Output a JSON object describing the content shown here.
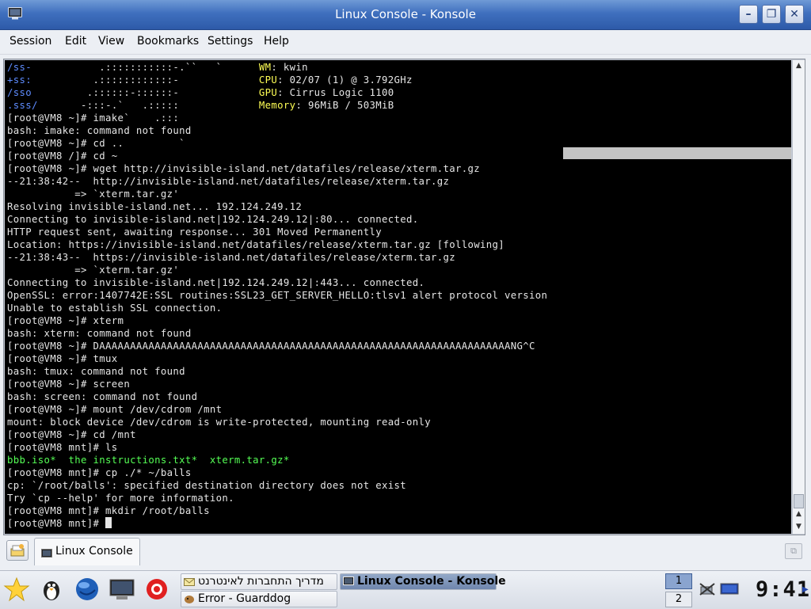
{
  "window": {
    "title": "Linux Console - Konsole",
    "buttons": {
      "minimize": "–",
      "maximize": "❐",
      "close": "✕"
    }
  },
  "menu": [
    "Session",
    "Edit",
    "View",
    "Bookmarks",
    "Settings",
    "Help"
  ],
  "terminal": {
    "lines": [
      [
        {
          "t": "/ss-",
          "c": "blue"
        },
        {
          "t": "           .:::::::::::-.``   `      "
        },
        {
          "t": "WM",
          "c": "yellow"
        },
        {
          "t": ": kwin"
        }
      ],
      [
        {
          "t": "+ss:",
          "c": "blue"
        },
        {
          "t": "          .::::::::::::-             "
        },
        {
          "t": "CPU",
          "c": "yellow"
        },
        {
          "t": ": 02/07 (1) @ 3.792GHz"
        }
      ],
      [
        {
          "t": "/sso",
          "c": "blue"
        },
        {
          "t": "         .::::::-::::::-             "
        },
        {
          "t": "GPU",
          "c": "yellow"
        },
        {
          "t": ": Cirrus Logic 1100"
        }
      ],
      [
        {
          "t": ".sss/",
          "c": "blue"
        },
        {
          "t": "       -:::-.`   .:::::             "
        },
        {
          "t": "Memory",
          "c": "yellow"
        },
        {
          "t": ": 96MiB / 503MiB"
        }
      ],
      [
        {
          "t": "[root@VM8 ~]# imake`    .:::"
        }
      ],
      [
        {
          "t": "bash: imake: command not found"
        }
      ],
      [
        {
          "t": "[root@VM8 ~]# cd ..         `"
        }
      ],
      [
        {
          "t": "[root@VM8 /]# cd ~"
        }
      ],
      [
        {
          "t": "[root@VM8 ~]# wget http://invisible-island.net/datafiles/release/xterm.tar.gz"
        }
      ],
      [
        {
          "t": "--21:38:42--  http://invisible-island.net/datafiles/release/xterm.tar.gz"
        }
      ],
      [
        {
          "t": "           => `xterm.tar.gz'"
        }
      ],
      [
        {
          "t": "Resolving invisible-island.net... 192.124.249.12"
        }
      ],
      [
        {
          "t": "Connecting to invisible-island.net|192.124.249.12|:80... connected."
        }
      ],
      [
        {
          "t": "HTTP request sent, awaiting response... 301 Moved Permanently"
        }
      ],
      [
        {
          "t": "Location: https://invisible-island.net/datafiles/release/xterm.tar.gz [following]"
        }
      ],
      [
        {
          "t": "--21:38:43--  https://invisible-island.net/datafiles/release/xterm.tar.gz"
        }
      ],
      [
        {
          "t": "           => `xterm.tar.gz'"
        }
      ],
      [
        {
          "t": "Connecting to invisible-island.net|192.124.249.12|:443... connected."
        }
      ],
      [
        {
          "t": "OpenSSL: error:1407742E:SSL routines:SSL23_GET_SERVER_HELLO:tlsv1 alert protocol version"
        }
      ],
      [
        {
          "t": "Unable to establish SSL connection."
        }
      ],
      [
        {
          "t": "[root@VM8 ~]# xterm"
        }
      ],
      [
        {
          "t": "bash: xterm: command not found"
        }
      ],
      [
        {
          "t": "[root@VM8 ~]# DAAAAAAAAAAAAAAAAAAAAAAAAAAAAAAAAAAAAAAAAAAAAAAAAAAAAAAAAAAAAAAAAAAANG^C"
        }
      ],
      [
        {
          "t": "[root@VM8 ~]# tmux"
        }
      ],
      [
        {
          "t": "bash: tmux: command not found"
        }
      ],
      [
        {
          "t": "[root@VM8 ~]# screen"
        }
      ],
      [
        {
          "t": "bash: screen: command not found"
        }
      ],
      [
        {
          "t": "[root@VM8 ~]# mount /dev/cdrom /mnt"
        }
      ],
      [
        {
          "t": "mount: block device /dev/cdrom is write-protected, mounting read-only"
        }
      ],
      [
        {
          "t": "[root@VM8 ~]# cd /mnt"
        }
      ],
      [
        {
          "t": "[root@VM8 mnt]# ls"
        }
      ],
      [
        {
          "t": "bbb.iso*  the instructions.txt*  xterm.tar.gz*",
          "c": "green"
        }
      ],
      [
        {
          "t": "[root@VM8 mnt]# cp ./* ~/balls"
        }
      ],
      [
        {
          "t": "cp: `/root/balls': specified destination directory does not exist"
        }
      ],
      [
        {
          "t": "Try `cp --help' for more information."
        }
      ],
      [
        {
          "t": "[root@VM8 mnt]# mkdir /root/balls"
        }
      ],
      [
        {
          "t": "[root@VM8 mnt]# "
        }
      ]
    ]
  },
  "tabs": [
    {
      "label": "Linux Console"
    }
  ],
  "taskbar": {
    "tasks": [
      {
        "label": "מדריך התחברות לאינטרנט"
      },
      {
        "label": "Linux Console - Konsole"
      },
      {
        "label": "Error - Guarddog"
      }
    ],
    "pager": [
      "1",
      "2"
    ],
    "clock": "9:41"
  },
  "colors": {
    "titlebar": "#3f6fbe",
    "terminal_bg": "#000000",
    "terminal_fg": "#e6e6e6",
    "prompt_blue": "#5e8cff",
    "label_yellow": "#ffff55",
    "exec_green": "#55ff55"
  }
}
